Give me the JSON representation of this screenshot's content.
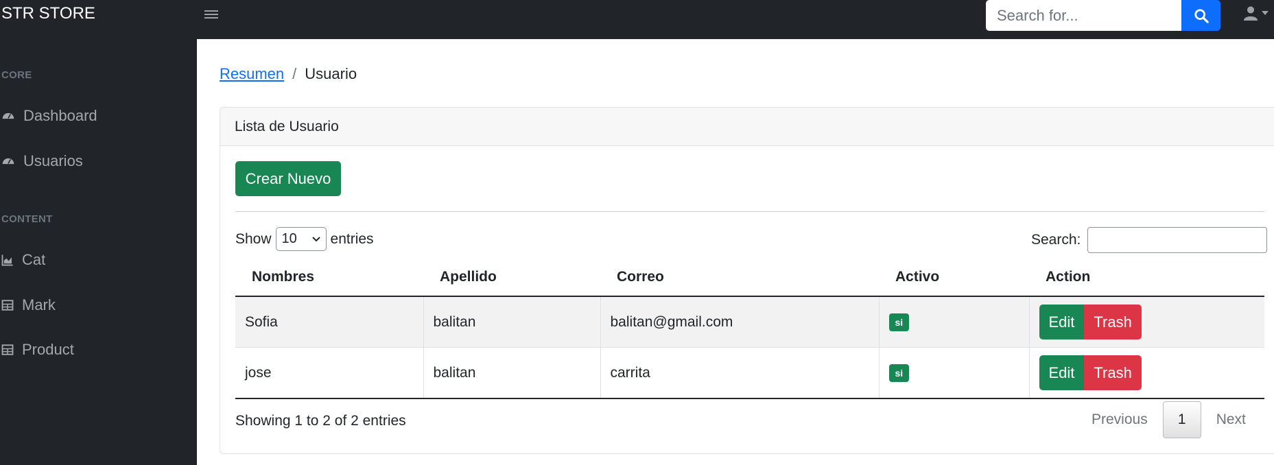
{
  "app": {
    "brand": "STR STORE"
  },
  "topbar": {
    "search_placeholder": "Search for...",
    "search_button_icon": "search-icon",
    "user_icon": "user-icon"
  },
  "sidebar": {
    "sections": [
      {
        "heading": "CORE"
      },
      {
        "heading": "CONTENT"
      }
    ],
    "items": [
      {
        "label": "Dashboard",
        "icon": "tachometer-icon"
      },
      {
        "label": "Usuarios",
        "icon": "tachometer-icon"
      },
      {
        "label": "Cat",
        "icon": "chart-area-icon"
      },
      {
        "label": "Mark",
        "icon": "table-icon"
      },
      {
        "label": "Product",
        "icon": "table-icon"
      }
    ]
  },
  "breadcrumb": {
    "link": "Resumen",
    "separator": "/",
    "current": "Usuario"
  },
  "card": {
    "title": "Lista de Usuario",
    "create_label": "Crear Nuevo",
    "show_label": "Show",
    "page_length": "10",
    "entries_label": "entries",
    "search_label": "Search:",
    "columns": [
      "Nombres",
      "Apellido",
      "Correo",
      "Activo",
      "Action"
    ],
    "rows": [
      {
        "nombres": "Sofia",
        "apellido": "balitan",
        "correo": "balitan@gmail.com",
        "activo": "si",
        "edit": "Edit",
        "trash": "Trash"
      },
      {
        "nombres": "jose",
        "apellido": "balitan",
        "correo": "carrita",
        "activo": "si",
        "edit": "Edit",
        "trash": "Trash"
      }
    ],
    "info": "Showing 1 to 2 of 2 entries",
    "pager": {
      "previous": "Previous",
      "current_page": "1",
      "next": "Next"
    }
  },
  "colors": {
    "navbar": "#212529",
    "primary": "#0d6efd",
    "success": "#198754",
    "danger": "#dc3545"
  }
}
